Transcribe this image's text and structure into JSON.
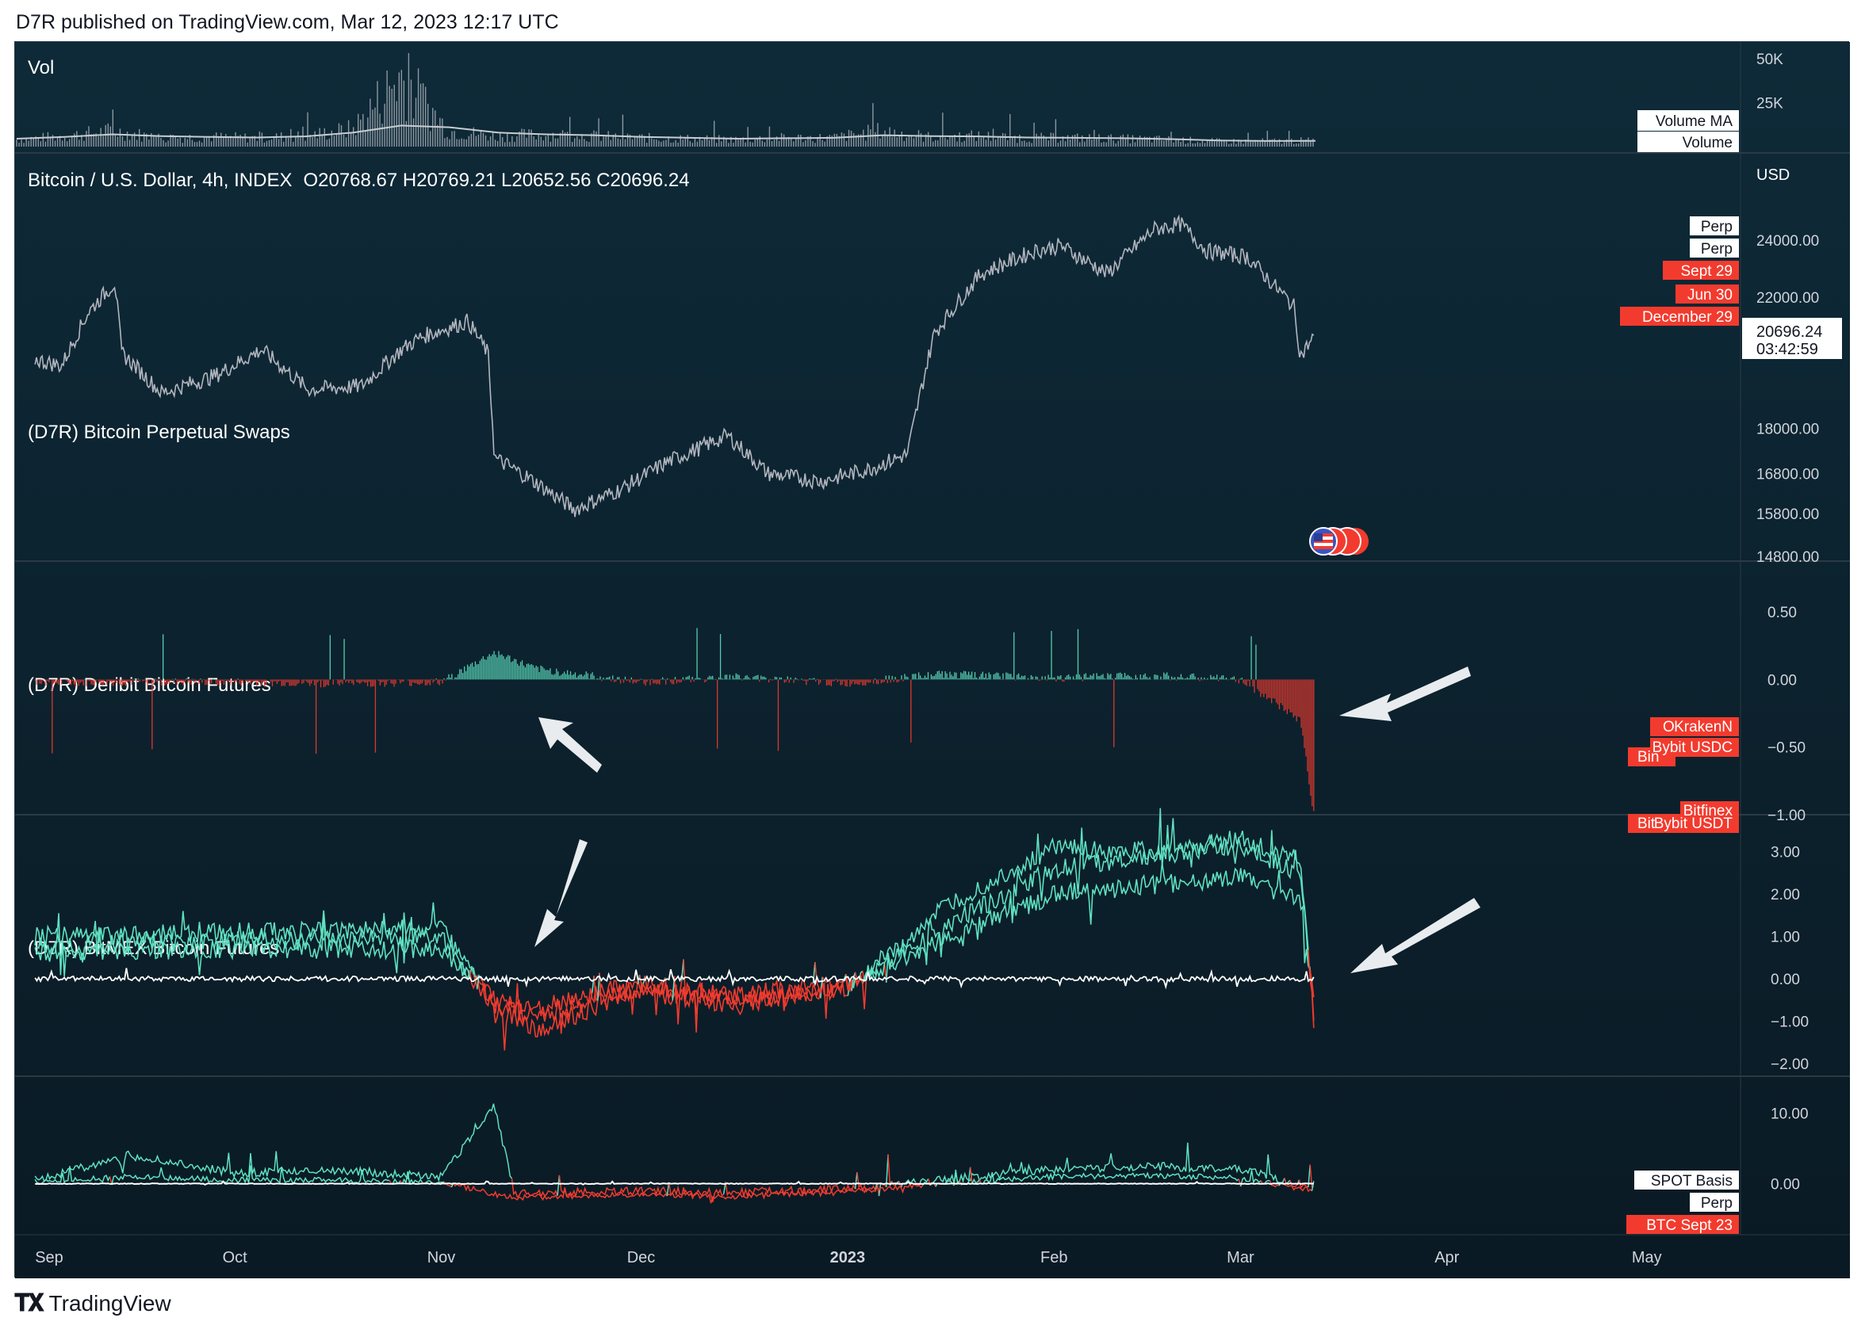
{
  "header": {
    "publish_text": "D7R published on TradingView.com, Mar 12, 2023 12:17 UTC"
  },
  "footer": {
    "brand": "TradingView"
  },
  "panes": {
    "vol": {
      "title": "Vol",
      "ticks": [
        "50K",
        "25K"
      ],
      "labels": [
        "Volume MA",
        "Volume"
      ]
    },
    "price": {
      "title": "Bitcoin / U.S. Dollar, 4h, INDEX",
      "ohlc": "O20768.67  H20769.21  L20652.56  C20696.24",
      "currency": "USD",
      "ticks": [
        "24000.00",
        "22000.00",
        "18000.00",
        "16800.00",
        "15800.00",
        "14800.00"
      ],
      "last_price": "20696.24",
      "countdown": "03:42:59"
    },
    "perp": {
      "title": "(D7R) Bitcoin Perpetual Swaps",
      "ticks": [
        "0.50",
        "0.00",
        "−0.50",
        "−1.00"
      ],
      "labels": [
        "O",
        "KrakenN",
        "Bybit USDC",
        "Bin",
        "Bitfinex",
        "Bit",
        "Bybit USDT"
      ]
    },
    "deribit": {
      "title": "(D7R) Deribit Bitcoin Futures",
      "ticks": [
        "3.00",
        "2.00",
        "1.00",
        "0.00",
        "−1.00",
        "−2.00"
      ],
      "labels": [
        "Perp",
        "Perp",
        "Sept 29",
        "Jun 30",
        "December 29"
      ]
    },
    "bitmex": {
      "title": "(D7R) BitMEX Bitcoin Futures",
      "ticks": [
        "10.00",
        "0.00"
      ],
      "labels": [
        "SPOT Basis",
        "Perp",
        "BTC Sept 23"
      ]
    }
  },
  "time_axis": [
    "Sep",
    "Oct",
    "Nov",
    "Dec",
    "2023",
    "Feb",
    "Mar",
    "Apr",
    "May"
  ],
  "colors": {
    "background": "#0c1f2c",
    "teal": "#5fe0c0",
    "red": "#f23b2e",
    "price_line": "#b2b5be",
    "label_red": "#f23b2e"
  },
  "chart_data": [
    {
      "type": "bar",
      "title": "Vol",
      "series": [
        {
          "name": "Volume",
          "values": [
            4000,
            6000,
            9000,
            5000,
            5500,
            5000,
            6000,
            10000,
            40000,
            9000,
            6000,
            7000,
            6000,
            5000,
            4500,
            4000,
            5000,
            5000,
            9000,
            5500,
            6000,
            5000,
            5000,
            4500,
            4000,
            3000,
            3000,
            3500
          ]
        },
        {
          "name": "Volume MA",
          "values": [
            4500,
            5500,
            7000,
            6000,
            5500,
            5200,
            5800,
            8000,
            12000,
            11000,
            8000,
            7000,
            6500,
            5500,
            5000,
            4500,
            4800,
            5000,
            6500,
            6000,
            5800,
            5200,
            5000,
            4800,
            4300,
            3500,
            3200,
            3300
          ]
        }
      ],
      "ylim": [
        0,
        55000
      ]
    },
    {
      "type": "line",
      "title": "Bitcoin / U.S. Dollar, 4h, INDEX",
      "x": [
        "2022-09-01",
        "2022-09-05",
        "2022-09-09",
        "2022-09-13",
        "2022-09-14",
        "2022-09-20",
        "2022-09-28",
        "2022-10-05",
        "2022-10-12",
        "2022-10-20",
        "2022-10-26",
        "2022-10-29",
        "2022-11-05",
        "2022-11-08",
        "2022-11-09",
        "2022-11-14",
        "2022-11-21",
        "2022-11-28",
        "2022-12-05",
        "2022-12-14",
        "2022-12-20",
        "2022-12-28",
        "2023-01-04",
        "2023-01-10",
        "2023-01-14",
        "2023-01-21",
        "2023-01-29",
        "2023-02-02",
        "2023-02-09",
        "2023-02-16",
        "2023-02-20",
        "2023-02-24",
        "2023-03-02",
        "2023-03-06",
        "2023-03-09",
        "2023-03-10",
        "2023-03-12"
      ],
      "y": [
        20000,
        19800,
        21500,
        22500,
        20200,
        19000,
        19500,
        20300,
        19100,
        19200,
        20300,
        20700,
        21200,
        20200,
        17200,
        16700,
        15900,
        16400,
        17100,
        17800,
        16800,
        16600,
        16900,
        17300,
        20800,
        22800,
        23600,
        23800,
        22800,
        24400,
        24600,
        23600,
        23400,
        22400,
        21700,
        20100,
        20696.24
      ],
      "ylabel": "USD",
      "ylim": [
        14800,
        25500
      ]
    },
    {
      "type": "bar",
      "title": "(D7R) Bitcoin Perpetual Swaps",
      "x": [
        "2022-09-01",
        "2022-09-15",
        "2022-10-01",
        "2022-10-15",
        "2022-11-01",
        "2022-11-09",
        "2022-11-15",
        "2022-12-01",
        "2022-12-15",
        "2023-01-01",
        "2023-01-15",
        "2023-02-01",
        "2023-02-15",
        "2023-03-01",
        "2023-03-10",
        "2023-03-12"
      ],
      "series": [
        {
          "name": "Funding",
          "values": [
            -0.03,
            -0.02,
            -0.02,
            -0.03,
            -0.02,
            0.2,
            0.08,
            -0.02,
            0.02,
            -0.03,
            0.04,
            0.01,
            0.03,
            0.0,
            -0.3,
            -1.0
          ]
        }
      ],
      "ylim": [
        -1.0,
        0.7
      ]
    },
    {
      "type": "line",
      "title": "(D7R) Deribit Bitcoin Futures",
      "x": [
        "2022-09-01",
        "2022-10-01",
        "2022-11-01",
        "2022-11-09",
        "2022-11-15",
        "2022-12-01",
        "2022-12-15",
        "2023-01-01",
        "2023-01-15",
        "2023-02-01",
        "2023-02-15",
        "2023-03-01",
        "2023-03-10",
        "2023-03-12"
      ],
      "series": [
        {
          "name": "Perp",
          "values": [
            0.0,
            0.0,
            0.0,
            0.0,
            0.0,
            0.0,
            0.0,
            0.0,
            0.0,
            0.0,
            0.0,
            0.0,
            0.0,
            0.0
          ]
        },
        {
          "name": "Sept 29",
          "values": [
            0.8,
            0.9,
            1.0,
            -0.6,
            -0.9,
            -0.2,
            -0.5,
            -0.2,
            1.2,
            2.6,
            2.9,
            3.1,
            2.5,
            -0.8
          ]
        },
        {
          "name": "Jun 30",
          "values": [
            0.6,
            0.7,
            0.7,
            -0.5,
            -0.7,
            -0.1,
            -0.4,
            -0.1,
            0.9,
            2.0,
            2.2,
            2.4,
            1.8,
            -0.6
          ]
        },
        {
          "name": "December 29",
          "values": [
            1.0,
            1.1,
            1.2,
            -0.7,
            -1.2,
            -0.3,
            -0.6,
            -0.2,
            1.6,
            3.1,
            3.0,
            3.3,
            2.8,
            -1.0
          ]
        }
      ],
      "ylim": [
        -2.3,
        3.5
      ]
    },
    {
      "type": "line",
      "title": "(D7R) BitMEX Bitcoin Futures",
      "x": [
        "2022-09-01",
        "2022-09-15",
        "2022-10-01",
        "2022-10-15",
        "2022-11-01",
        "2022-11-09",
        "2022-11-12",
        "2022-12-01",
        "2022-12-15",
        "2023-01-01",
        "2023-01-15",
        "2023-02-01",
        "2023-02-15",
        "2023-03-01",
        "2023-03-12"
      ],
      "series": [
        {
          "name": "SPOT Basis",
          "values": [
            0.0,
            0.0,
            0.0,
            0.0,
            0.0,
            0.0,
            0.0,
            0.0,
            0.0,
            0.0,
            0.0,
            0.0,
            0.0,
            0.0,
            0.0
          ]
        },
        {
          "name": "Perp",
          "values": [
            0.5,
            4.0,
            1.5,
            2.0,
            1.0,
            11.0,
            -1.5,
            -1.0,
            -1.2,
            -0.8,
            0.5,
            2.0,
            2.5,
            2.0,
            -0.5
          ]
        },
        {
          "name": "BTC Sept 23",
          "values": [
            0.2,
            1.0,
            0.5,
            0.5,
            0.2,
            -1.5,
            -2.0,
            -1.5,
            -1.8,
            -1.2,
            0.0,
            1.0,
            1.2,
            0.8,
            -1.0
          ]
        }
      ],
      "ylim": [
        -5,
        13
      ]
    }
  ]
}
